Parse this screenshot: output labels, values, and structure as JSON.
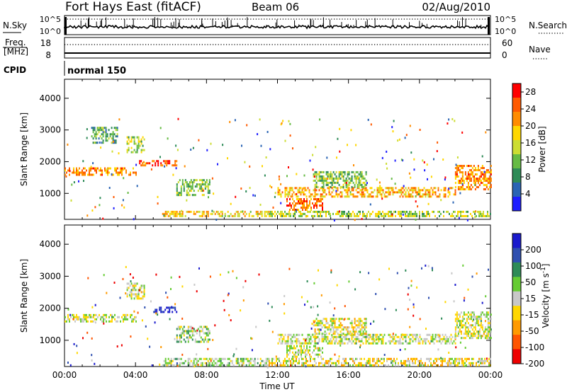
{
  "header": {
    "station": "Fort Hays East (fitACF)",
    "beam": "Beam 06",
    "date": "02/Aug/2010"
  },
  "status_panel": {
    "nsky": {
      "label": "N.Sky",
      "ticks": [
        "10^5",
        "10^0"
      ],
      "right_label": "N.Search",
      "right_ticks": [
        "10^5",
        "10^0"
      ]
    },
    "freq": {
      "label_line1": "Freq.",
      "label_line2": "[MHz]",
      "ticks": [
        "18",
        "8"
      ],
      "right_label": "Nave",
      "right_ticks": [
        "60",
        "0"
      ]
    },
    "cpid": {
      "label": "CPID",
      "mode": "normal 150"
    }
  },
  "colors": {
    "power_scale": [
      "#1e1eff",
      "#2a64b4",
      "#2e8b57",
      "#66bb44",
      "#ccdd33",
      "#ffd700",
      "#ff8c00",
      "#ff5a00",
      "#ff0000"
    ],
    "velocity_scale": [
      "#1a1acd",
      "#2f4fb0",
      "#2e8b57",
      "#66cc33",
      "#c8c8c8",
      "#ffd700",
      "#ff9a00",
      "#ff5500",
      "#ee0000"
    ]
  },
  "chart_data": [
    {
      "type": "heatmap",
      "title": "Power",
      "xlabel": "",
      "ylabel": "Slant Range [km]",
      "x_ticks": [
        "00:00",
        "04:00",
        "08:00",
        "12:00",
        "16:00",
        "20:00",
        "00:00"
      ],
      "y_ticks": [
        1000,
        2000,
        3000,
        4000
      ],
      "ylim": [
        180,
        4600
      ],
      "colorbar": {
        "label": "Power [dB]",
        "ticks": [
          4,
          8,
          12,
          16,
          20,
          24,
          28
        ],
        "range": [
          0,
          30
        ]
      },
      "echo_regions": [
        {
          "t": [
            0.0,
            4.0
          ],
          "r": [
            1580,
            1820
          ],
          "value": 22
        },
        {
          "t": [
            4.2,
            6.3
          ],
          "r": [
            1880,
            2050
          ],
          "value": 26
        },
        {
          "t": [
            3.5,
            4.5
          ],
          "r": [
            2300,
            2800
          ],
          "value": 14
        },
        {
          "t": [
            1.5,
            3.0
          ],
          "r": [
            2600,
            3100
          ],
          "value": 10
        },
        {
          "t": [
            6.3,
            8.2
          ],
          "r": [
            950,
            1450
          ],
          "value": 12
        },
        {
          "t": [
            5.5,
            11.5
          ],
          "r": [
            250,
            450
          ],
          "value": 18
        },
        {
          "t": [
            12.0,
            22.0
          ],
          "r": [
            900,
            1200
          ],
          "value": 20
        },
        {
          "t": [
            12.5,
            14.5
          ],
          "r": [
            500,
            850
          ],
          "value": 24
        },
        {
          "t": [
            14.0,
            17.0
          ],
          "r": [
            1200,
            1700
          ],
          "value": 12
        },
        {
          "t": [
            22.0,
            24.0
          ],
          "r": [
            1100,
            1900
          ],
          "value": 22
        },
        {
          "t": [
            11.5,
            24.0
          ],
          "r": [
            250,
            450
          ],
          "value": 14
        }
      ]
    },
    {
      "type": "heatmap",
      "title": "Velocity",
      "xlabel": "Time UT",
      "ylabel": "Slant Range [km]",
      "x_ticks": [
        "00:00",
        "04:00",
        "08:00",
        "12:00",
        "16:00",
        "20:00",
        "00:00"
      ],
      "y_ticks": [
        1000,
        2000,
        3000,
        4000
      ],
      "ylim": [
        180,
        4600
      ],
      "colorbar": {
        "label": "Velocity [m s^-1]",
        "ticks": [
          200,
          100,
          50,
          15,
          -15,
          -50,
          -100,
          -200
        ],
        "range": [
          -250,
          250
        ]
      },
      "echo_regions": [
        {
          "t": [
            0.0,
            4.0
          ],
          "r": [
            1580,
            1820
          ],
          "value": 0
        },
        {
          "t": [
            5.0,
            6.3
          ],
          "r": [
            1880,
            2050
          ],
          "value": 220
        },
        {
          "t": [
            3.5,
            4.5
          ],
          "r": [
            2300,
            2800
          ],
          "value": 0
        },
        {
          "t": [
            6.3,
            8.2
          ],
          "r": [
            950,
            1450
          ],
          "value": 40
        },
        {
          "t": [
            5.5,
            11.5
          ],
          "r": [
            250,
            450
          ],
          "value": 30
        },
        {
          "t": [
            12.0,
            22.0
          ],
          "r": [
            900,
            1200
          ],
          "value": 0
        },
        {
          "t": [
            12.5,
            14.5
          ],
          "r": [
            500,
            850
          ],
          "value": 0
        },
        {
          "t": [
            14.0,
            17.0
          ],
          "r": [
            1200,
            1700
          ],
          "value": -20
        },
        {
          "t": [
            22.0,
            24.0
          ],
          "r": [
            1100,
            1900
          ],
          "value": 0
        },
        {
          "t": [
            11.5,
            24.0
          ],
          "r": [
            250,
            450
          ],
          "value": -30
        }
      ]
    }
  ]
}
